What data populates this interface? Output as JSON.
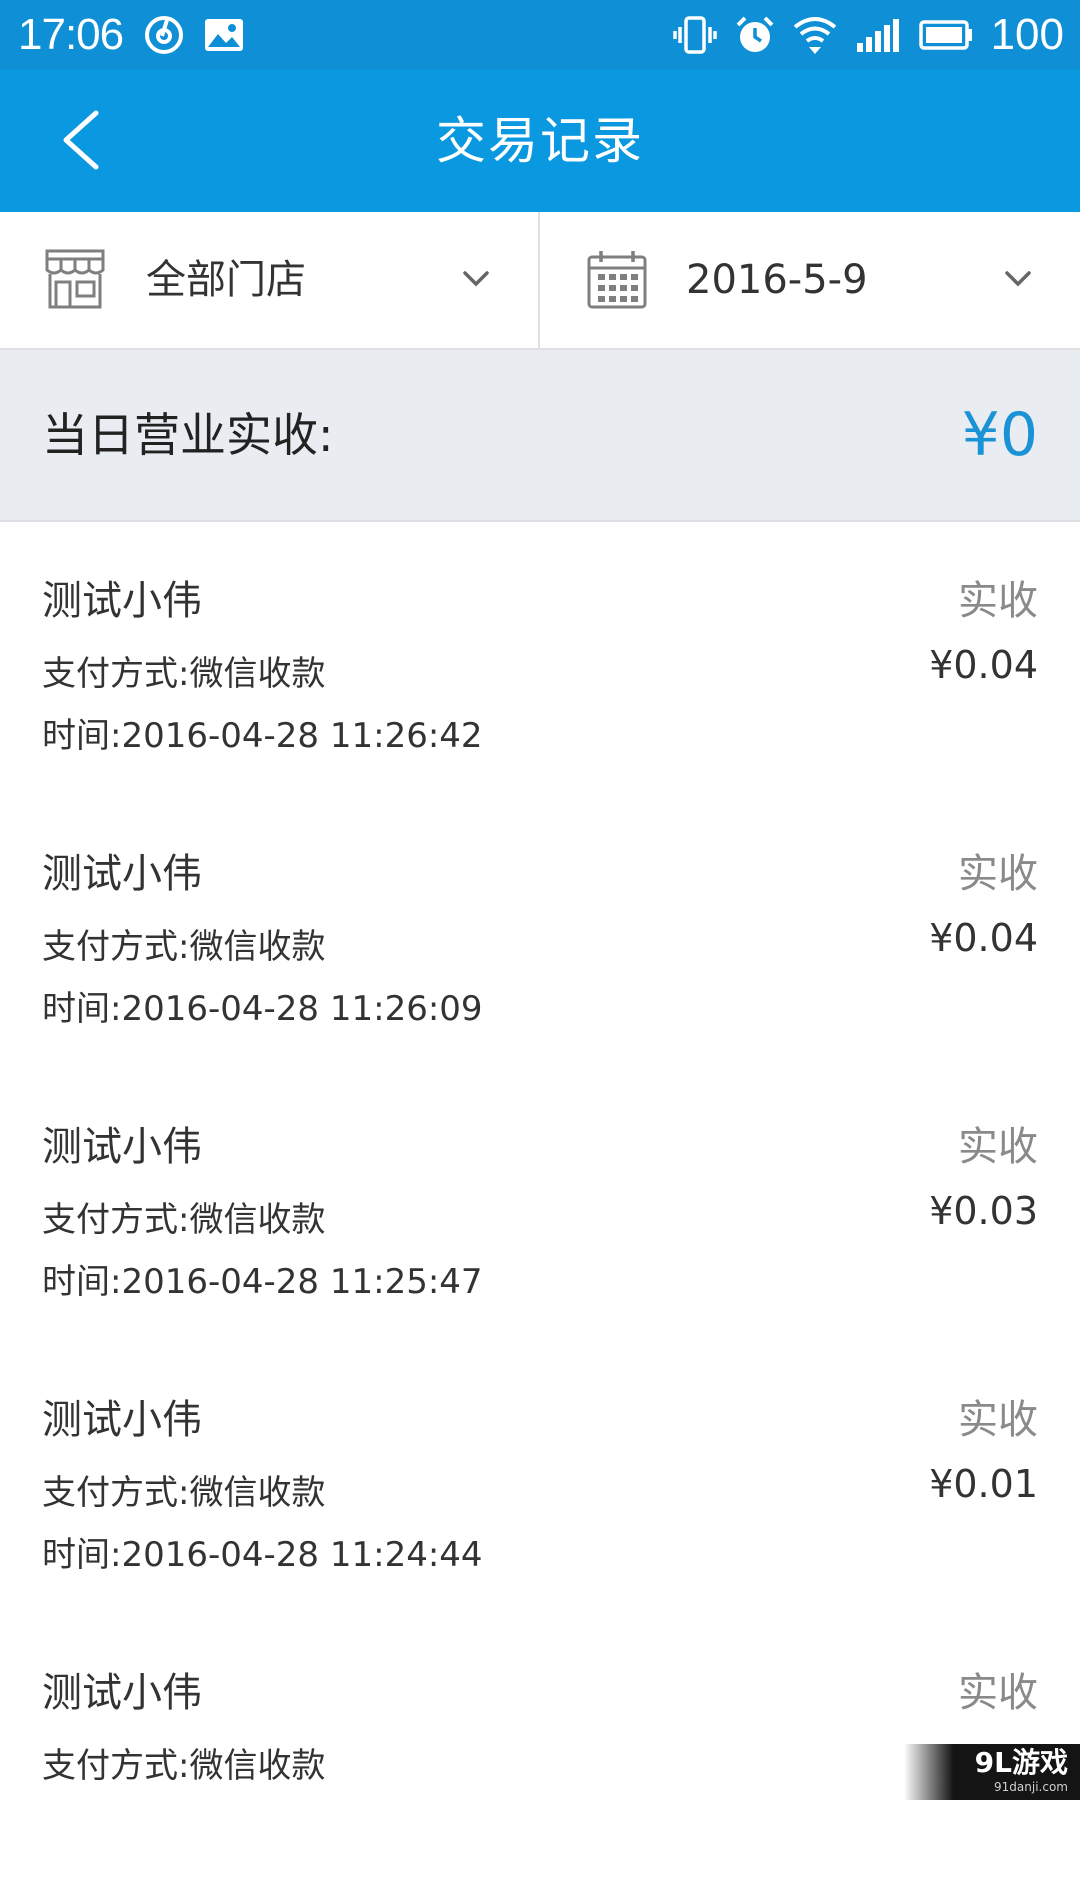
{
  "status_bar": {
    "time": "17:06",
    "battery_level": "100",
    "icons_left": [
      "netease-music-icon",
      "gallery-icon"
    ],
    "icons_right": [
      "vibrate-icon",
      "alarm-icon",
      "wifi-icon",
      "signal-icon",
      "battery-icon"
    ]
  },
  "header": {
    "title": "交易记录",
    "back_icon": "chevron-left-icon",
    "bg_color": "#0a98e0"
  },
  "filters": {
    "store": {
      "label": "全部门店",
      "icon": "store-icon"
    },
    "date": {
      "label": "2016-5-9",
      "icon": "calendar-icon"
    }
  },
  "summary": {
    "label": "当日营业实收:",
    "value": "¥0",
    "value_color": "#1a93d6"
  },
  "records": [
    {
      "name": "测试小伟",
      "status": "实收",
      "method": "支付方式:微信收款",
      "amount": "¥0.04",
      "time": "时间:2016-04-28 11:26:42"
    },
    {
      "name": "测试小伟",
      "status": "实收",
      "method": "支付方式:微信收款",
      "amount": "¥0.04",
      "time": "时间:2016-04-28 11:26:09"
    },
    {
      "name": "测试小伟",
      "status": "实收",
      "method": "支付方式:微信收款",
      "amount": "¥0.03",
      "time": "时间:2016-04-28 11:25:47"
    },
    {
      "name": "测试小伟",
      "status": "实收",
      "method": "支付方式:微信收款",
      "amount": "¥0.01",
      "time": "时间:2016-04-28 11:24:44"
    },
    {
      "name": "测试小伟",
      "status": "实收",
      "method": "支付方式:微信收款",
      "amount": "",
      "time": ""
    }
  ],
  "watermark": {
    "main": "9L游戏",
    "sub": "91danji.com"
  }
}
